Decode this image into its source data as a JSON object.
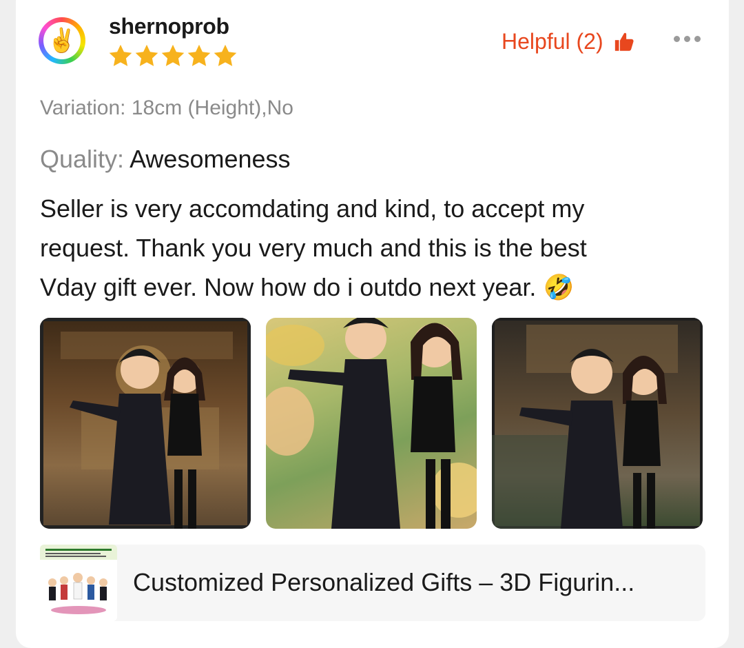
{
  "review": {
    "username": "shernoprob",
    "avatar_icon": "victory-hand-icon",
    "rating": 5,
    "rating_max": 5,
    "helpful_label": "Helpful (2)",
    "helpful_icon": "thumbs-up-icon",
    "more_icon": "more-dots-icon",
    "variation": "Variation: 18cm (Height),No",
    "quality_label": "Quality:",
    "quality_value": "Awesomeness",
    "text_line1": "Seller is very accomdating and kind, to accept my",
    "text_line2": "request. Thank you very much and this is the best",
    "text_line3": "Vday gift ever. Now how do i outdo next year.",
    "emoji": "🤣",
    "photos": [
      {
        "name": "review-photo-1"
      },
      {
        "name": "review-photo-2"
      },
      {
        "name": "review-photo-3"
      }
    ]
  },
  "product": {
    "title": "Customized Personalized Gifts – 3D Figurin..."
  },
  "colors": {
    "accent": "#e8471e",
    "star": "#f7b21d",
    "muted": "#8a8a8a"
  }
}
